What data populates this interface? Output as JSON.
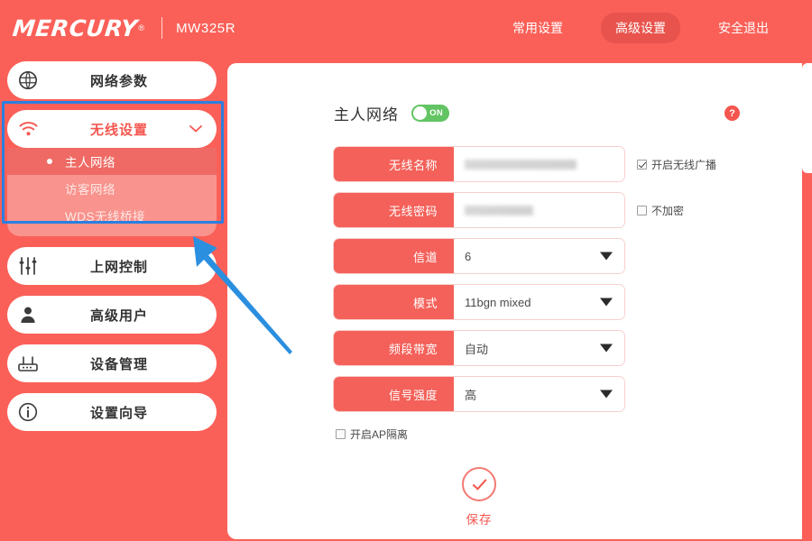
{
  "header": {
    "brand": "MERCURY",
    "registered_mark": "®",
    "model": "MW325R",
    "nav": [
      {
        "label": "常用设置",
        "active": false
      },
      {
        "label": "高级设置",
        "active": true
      },
      {
        "label": "安全退出",
        "active": false
      }
    ]
  },
  "sidebar": {
    "items": [
      {
        "label": "网络参数",
        "icon": "globe-icon",
        "active": false,
        "expandable": false
      },
      {
        "label": "无线设置",
        "icon": "wifi-icon",
        "active": true,
        "expandable": true
      },
      {
        "label": "上网控制",
        "icon": "sliders-icon",
        "active": false,
        "expandable": false
      },
      {
        "label": "高级用户",
        "icon": "user-icon",
        "active": false,
        "expandable": false
      },
      {
        "label": "设备管理",
        "icon": "router-icon",
        "active": false,
        "expandable": false
      },
      {
        "label": "设置向导",
        "icon": "info-icon",
        "active": false,
        "expandable": false
      }
    ],
    "submenu": [
      {
        "label": "主人网络",
        "selected": true
      },
      {
        "label": "访客网络",
        "selected": false
      },
      {
        "label": "WDS无线桥接",
        "selected": false
      }
    ]
  },
  "main": {
    "title": "主人网络",
    "toggle": {
      "state_label": "ON",
      "on": true
    },
    "help_icon_label": "?",
    "fields": [
      {
        "label": "无线名称",
        "value": "",
        "redacted": true,
        "type": "text",
        "side_checkbox": {
          "label": "开启无线广播",
          "checked": true
        }
      },
      {
        "label": "无线密码",
        "value": "",
        "redacted": true,
        "type": "password",
        "side_checkbox": {
          "label": "不加密",
          "checked": false
        }
      },
      {
        "label": "信道",
        "value": "6",
        "redacted": false,
        "type": "select"
      },
      {
        "label": "模式",
        "value": "11bgn mixed",
        "redacted": false,
        "type": "select"
      },
      {
        "label": "频段带宽",
        "value": "自动",
        "redacted": false,
        "type": "select"
      },
      {
        "label": "信号强度",
        "value": "高",
        "redacted": false,
        "type": "select"
      }
    ],
    "ap_isolation": {
      "label": "开启AP隔离",
      "checked": false
    },
    "save": {
      "label": "保存",
      "icon": "check-circle-icon"
    }
  },
  "annotations": {
    "highlight_rect": {
      "color": "#2b7fe0"
    },
    "pointer_arrow": {
      "color": "#2b8fe0"
    }
  },
  "colors": {
    "brand_red": "#fa6058",
    "label_red": "#f4615a",
    "accent_red": "#f4564f",
    "toggle_green": "#62c462",
    "annotation_blue": "#2b7fe0",
    "submenu_pink": "#f8938d"
  }
}
